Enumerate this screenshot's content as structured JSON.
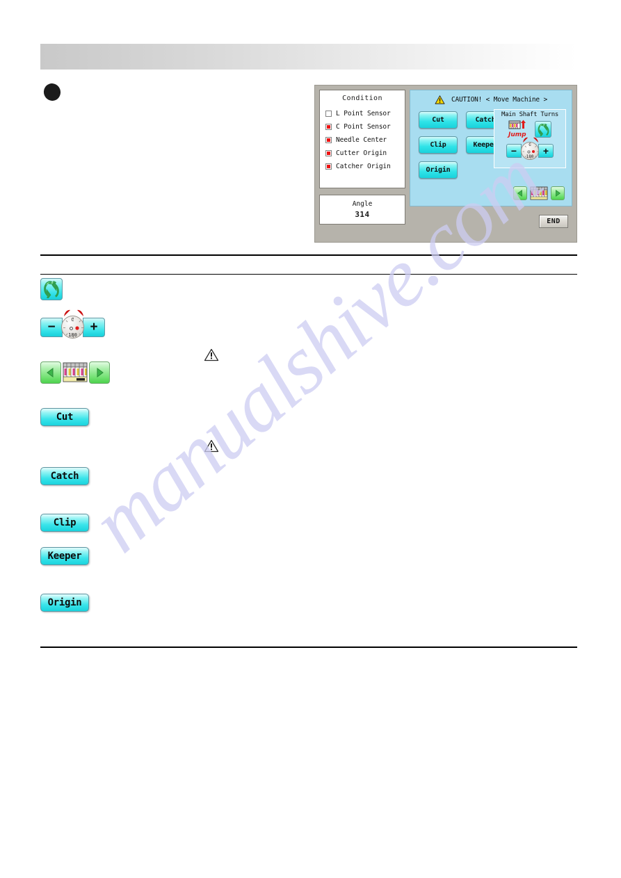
{
  "page": {
    "watermark": "manualshive.com",
    "header_bar": ""
  },
  "machine_screen": {
    "condition": {
      "title": "Condition",
      "items": [
        {
          "label": "L Point Sensor",
          "led": "off"
        },
        {
          "label": "C Point Sensor",
          "led": "on"
        },
        {
          "label": "Needle Center",
          "led": "on"
        },
        {
          "label": "Cutter Origin",
          "led": "on"
        },
        {
          "label": "Catcher Origin",
          "led": "on"
        }
      ]
    },
    "angle": {
      "title": "Angle",
      "value": "314"
    },
    "caution": {
      "icon": "warning-triangle-icon",
      "text": "CAUTION! < Move Machine >"
    },
    "actions": [
      {
        "label": "Cut"
      },
      {
        "label": "Catch"
      },
      {
        "label": "Clip"
      },
      {
        "label": "Keeper"
      },
      {
        "label": "Origin"
      }
    ],
    "main_shaft": {
      "title": "Main Shaft Turns",
      "jump_icon_label": "Jump",
      "rotate_icon": "rotate-icon",
      "minus_label": "−",
      "plus_label": "+",
      "dial_top_label": "C",
      "dial_bottom_label": "180"
    },
    "needle_nav": {
      "left_icon": "arrow-left-icon",
      "needle_icon": "needle-bar-icon",
      "right_icon": "arrow-right-icon"
    },
    "end_button": "END"
  },
  "legend": {
    "rotate_icon": "rotate-icon",
    "stepper": {
      "minus": "−",
      "plus": "+",
      "dial_top_label": "C",
      "dial_bottom_label": "180"
    },
    "needle_nav": {
      "left_icon": "arrow-left-icon",
      "needle_icon": "needle-bar-icon",
      "right_icon": "arrow-right-icon"
    },
    "buttons": [
      {
        "label": "Cut"
      },
      {
        "label": "Catch"
      },
      {
        "label": "Clip"
      },
      {
        "label": "Keeper"
      },
      {
        "label": "Origin"
      }
    ]
  },
  "colors": {
    "cyan_button": "#2fe3e8",
    "green_arrow": "#6fe06f",
    "led_on": "#ee1111",
    "caution_panel": "#a8ddf0",
    "screen_frame": "#b6b3ab",
    "watermark": "#cdcdf2"
  }
}
